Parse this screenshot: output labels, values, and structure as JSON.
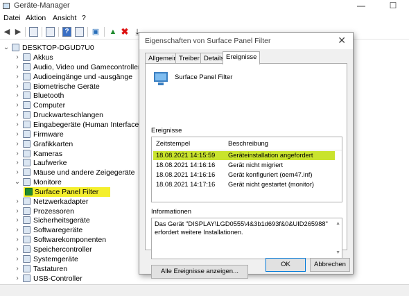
{
  "window": {
    "title": "Geräte-Manager",
    "minimize": "—",
    "maximize": "☐"
  },
  "menu": [
    "Datei",
    "Aktion",
    "Ansicht",
    "?"
  ],
  "tree": {
    "root": "DESKTOP-DGUD7U0",
    "items": [
      {
        "label": "Akkus",
        "expanded": false
      },
      {
        "label": "Audio, Video und Gamecontroller",
        "expanded": false
      },
      {
        "label": "Audioeingänge und -ausgänge",
        "expanded": false
      },
      {
        "label": "Biometrische Geräte",
        "expanded": false
      },
      {
        "label": "Bluetooth",
        "expanded": false
      },
      {
        "label": "Computer",
        "expanded": false
      },
      {
        "label": "Druckwarteschlangen",
        "expanded": false
      },
      {
        "label": "Eingabegeräte (Human Interface Devic",
        "expanded": false
      },
      {
        "label": "Firmware",
        "expanded": false
      },
      {
        "label": "Grafikkarten",
        "expanded": false
      },
      {
        "label": "Kameras",
        "expanded": false
      },
      {
        "label": "Laufwerke",
        "expanded": false
      },
      {
        "label": "Mäuse und andere Zeigegeräte",
        "expanded": false
      },
      {
        "label": "Monitore",
        "expanded": true
      },
      {
        "label": "Surface Panel Filter",
        "child": true,
        "highlighted": true
      },
      {
        "label": "Netzwerkadapter",
        "expanded": false
      },
      {
        "label": "Prozessoren",
        "expanded": false
      },
      {
        "label": "Sicherheitsgeräte",
        "expanded": false
      },
      {
        "label": "Softwaregeräte",
        "expanded": false
      },
      {
        "label": "Softwarekomponenten",
        "expanded": false
      },
      {
        "label": "Speichercontroller",
        "expanded": false
      },
      {
        "label": "Systemgeräte",
        "expanded": false
      },
      {
        "label": "Tastaturen",
        "expanded": false
      },
      {
        "label": "USB-Controller",
        "expanded": false
      }
    ]
  },
  "dialog": {
    "title": "Eigenschaften von Surface Panel Filter",
    "close": "✕",
    "tabs": [
      "Allgemein",
      "Treiber",
      "Details",
      "Ereignisse"
    ],
    "active_tab": "Ereignisse",
    "device_name": "Surface Panel Filter",
    "events_label": "Ereignisse",
    "columns": [
      "Zeitstempel",
      "Beschreibung"
    ],
    "events": [
      {
        "time": "18.08.2021 14:15:59",
        "desc": "Geräteinstallation angefordert",
        "selected": true
      },
      {
        "time": "18.08.2021 14:16:16",
        "desc": "Gerät nicht migriert",
        "selected": false
      },
      {
        "time": "18.08.2021 14:16:16",
        "desc": "Gerät konfiguriert (oem47.inf)",
        "selected": false
      },
      {
        "time": "18.08.2021 14:17:16",
        "desc": "Gerät nicht gestartet (monitor)",
        "selected": false
      }
    ],
    "info_label": "Informationen",
    "info_text": "Das Gerät \"DISPLAY\\LGD0555\\4&3b1d693f&0&UID265988\" erfordert weitere Installationen.",
    "all_events_button": "Alle Ereignisse anzeigen...",
    "ok_button": "OK",
    "cancel_button": "Abbrechen"
  },
  "colors": {
    "highlight_yellow": "#f4ef2d",
    "selected_row": "#c9e32d"
  }
}
